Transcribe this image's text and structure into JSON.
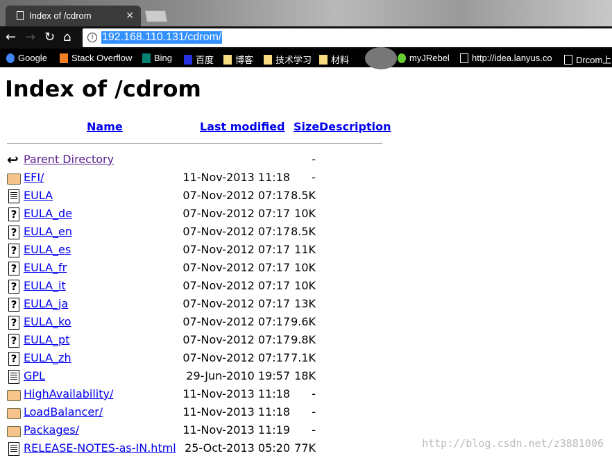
{
  "browser": {
    "tab_title": "Index of /cdrom",
    "url": "192.168.110.131/cdrom/",
    "bookmarks": [
      "Google",
      "Stack Overflow",
      "Bing",
      "百度",
      "博客",
      "技术学习",
      "材料",
      "myJRebel",
      "http://idea.lanyus.co",
      "Drcom上"
    ]
  },
  "page": {
    "title": "Index of /cdrom",
    "headers": {
      "name": "Name",
      "modified": "Last modified",
      "size": "Size",
      "description": "Description"
    },
    "rows": [
      {
        "icon": "back-icon",
        "name": "Parent Directory",
        "date": "",
        "size": "-"
      },
      {
        "icon": "folder-icon",
        "name": "EFI/",
        "date": "11-Nov-2013 11:18",
        "size": "-"
      },
      {
        "icon": "text-file-icon",
        "name": "EULA",
        "date": "07-Nov-2012 07:17",
        "size": "8.5K"
      },
      {
        "icon": "unknown-file-icon",
        "name": "EULA_de",
        "date": "07-Nov-2012 07:17",
        "size": "10K"
      },
      {
        "icon": "unknown-file-icon",
        "name": "EULA_en",
        "date": "07-Nov-2012 07:17",
        "size": "8.5K"
      },
      {
        "icon": "unknown-file-icon",
        "name": "EULA_es",
        "date": "07-Nov-2012 07:17",
        "size": "11K"
      },
      {
        "icon": "unknown-file-icon",
        "name": "EULA_fr",
        "date": "07-Nov-2012 07:17",
        "size": "10K"
      },
      {
        "icon": "unknown-file-icon",
        "name": "EULA_it",
        "date": "07-Nov-2012 07:17",
        "size": "10K"
      },
      {
        "icon": "unknown-file-icon",
        "name": "EULA_ja",
        "date": "07-Nov-2012 07:17",
        "size": "13K"
      },
      {
        "icon": "unknown-file-icon",
        "name": "EULA_ko",
        "date": "07-Nov-2012 07:17",
        "size": "9.6K"
      },
      {
        "icon": "unknown-file-icon",
        "name": "EULA_pt",
        "date": "07-Nov-2012 07:17",
        "size": "9.8K"
      },
      {
        "icon": "unknown-file-icon",
        "name": "EULA_zh",
        "date": "07-Nov-2012 07:17",
        "size": "7.1K"
      },
      {
        "icon": "text-file-icon",
        "name": "GPL",
        "date": "29-Jun-2010 19:57",
        "size": "18K"
      },
      {
        "icon": "folder-icon",
        "name": "HighAvailability/",
        "date": "11-Nov-2013 11:18",
        "size": "-"
      },
      {
        "icon": "folder-icon",
        "name": "LoadBalancer/",
        "date": "11-Nov-2013 11:18",
        "size": "-"
      },
      {
        "icon": "folder-icon",
        "name": "Packages/",
        "date": "11-Nov-2013 11:19",
        "size": "-"
      },
      {
        "icon": "text-file-icon",
        "name": "RELEASE-NOTES-as-IN.html",
        "date": "25-Oct-2013 05:20",
        "size": "77K"
      }
    ]
  },
  "watermark": "http://blog.csdn.net/z3881006"
}
